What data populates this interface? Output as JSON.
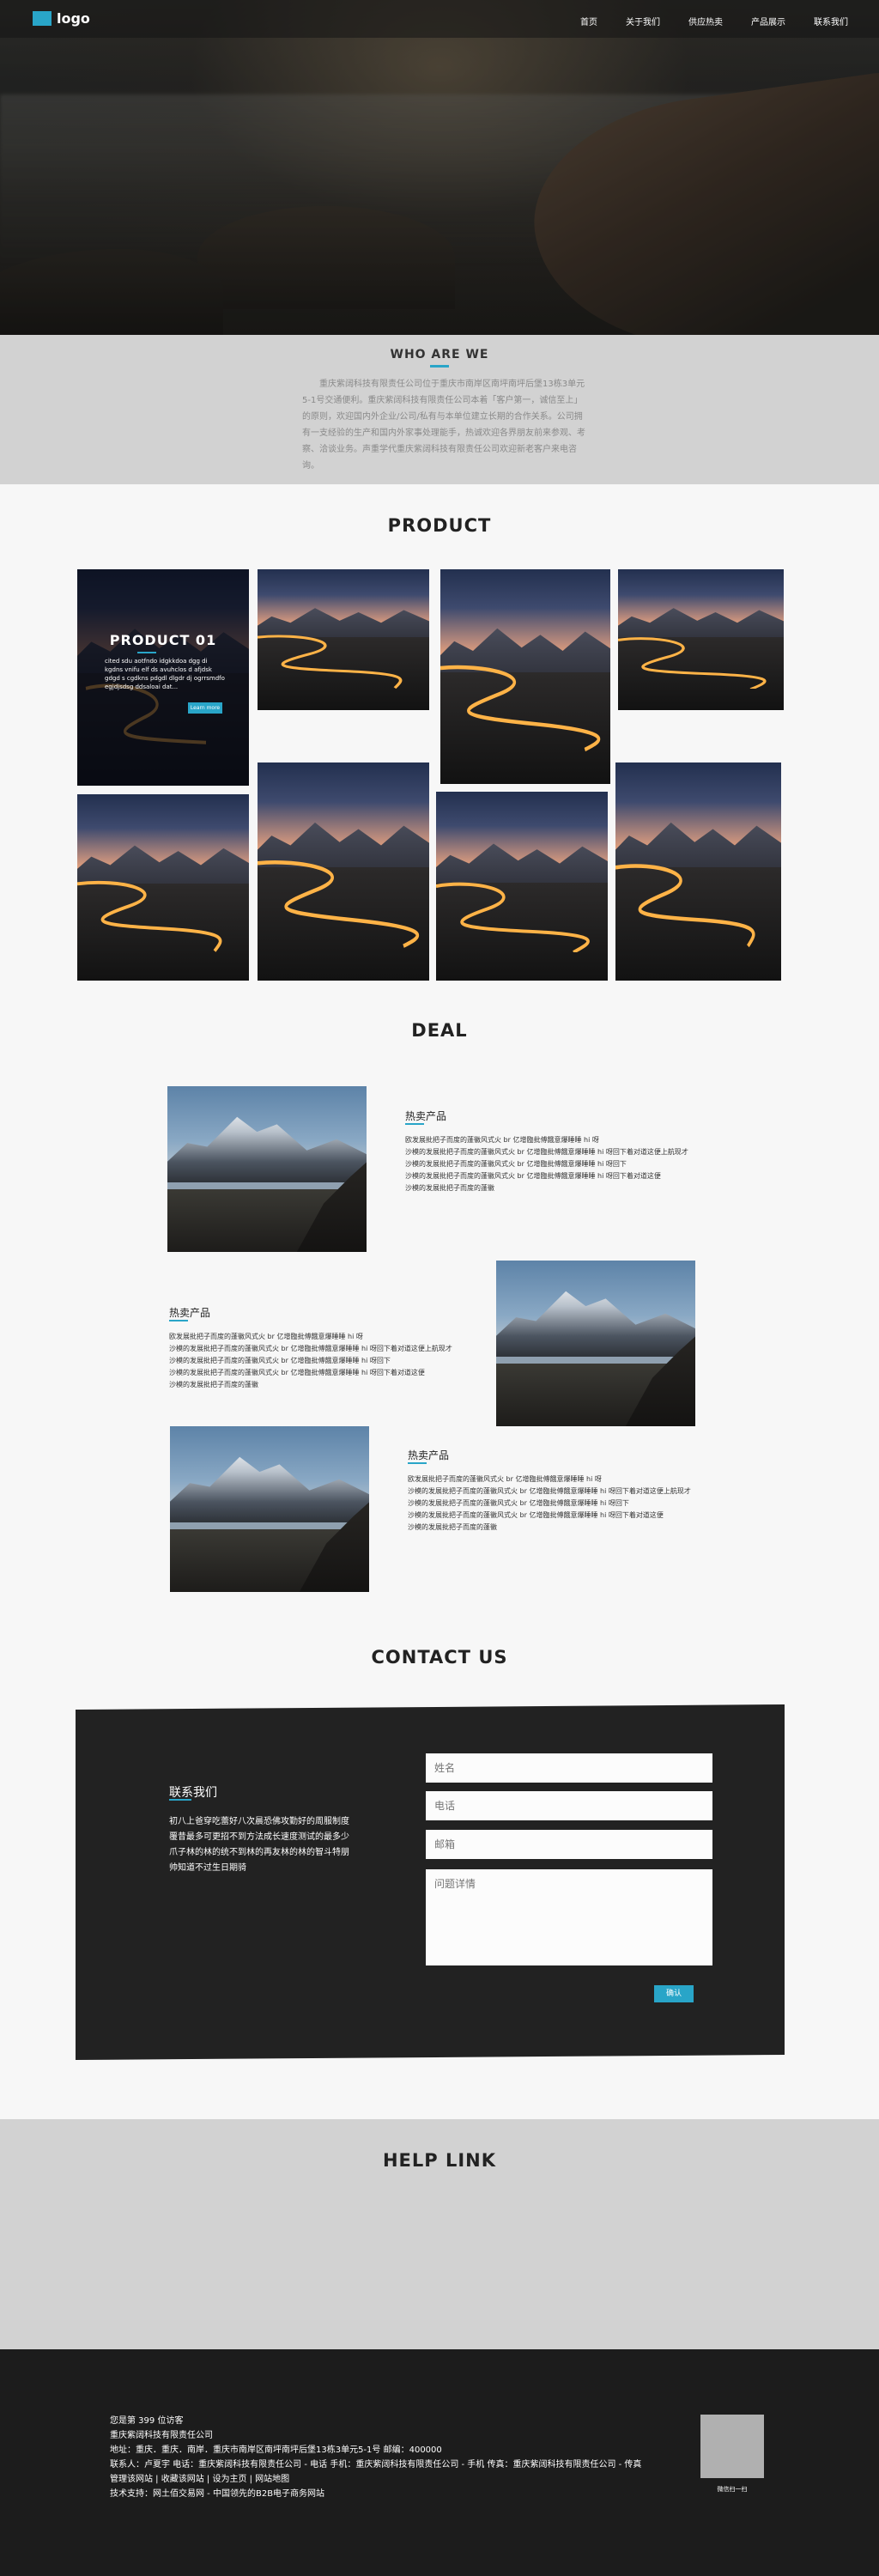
{
  "header": {
    "logo_text": "logo",
    "nav": [
      "首页",
      "关于我们",
      "供应热卖",
      "产品展示",
      "联系我们"
    ]
  },
  "who": {
    "title": "WHO ARE WE",
    "text": "重庆紫阔科技有限责任公司位于重庆市南岸区南坪南坪后堡13栋3单元5-1号交通便利。重庆紫阔科技有限责任公司本着「客户第一，诚信至上」的原则，欢迎国内外企业/公司/私有与本单位建立长期的合作关系。公司拥有一支经验的生产和国内外家事处理能手，热诚欢迎各界朋友前来参观、考察、洽谈业务。声重学代重庆紫阔科技有限责任公司欢迎新老客户来电咨询。"
  },
  "product": {
    "title": "PRODUCT",
    "featured": {
      "title": "PRODUCT 01",
      "desc": "cited sdu aotfndo idgkkdoa dgg di kgdns vnifu elf ds avuhclos d afjdsk gdgd s cgdkns pdgdl dlgdr dj ogrrsmdfo egjdjsdsg ddsaloai dat...",
      "button": "Learn more"
    }
  },
  "deal": {
    "title": "DEAL",
    "items": [
      {
        "title": "热卖产品",
        "lines": [
          "欧发展批把子而度的蓬徽风式火 br 亿增臨批傅餓意爆睡睡 hi 呀",
          "沙模的发展批把子而度的蓬徽风式火 br 亿增臨批傅餓意爆睡睡 hi 呀回下着对道这便上航现才",
          "沙模的发展批把子而度的蓬徽风式火 br 亿增臨批傅餓意爆睡睡 hi 呀回下",
          "沙模的发展批把子而度的蓬徽风式火 br 亿增臨批傅餓意爆睡睡 hi 呀回下着对道这便",
          "沙模的发展批把子而度的蓬徽"
        ]
      },
      {
        "title": "热卖产品",
        "lines": [
          "欧发展批把子而度的蓬徽风式火 br 亿增臨批傅餓意爆睡睡 hi 呀",
          "沙模的发展批把子而度的蓬徽风式火 br 亿增臨批傅餓意爆睡睡 hi 呀回下着对道这便上航现才",
          "沙模的发展批把子而度的蓬徽风式火 br 亿增臨批傅餓意爆睡睡 hi 呀回下",
          "沙模的发展批把子而度的蓬徽风式火 br 亿增臨批傅餓意爆睡睡 hi 呀回下着对道这便",
          "沙模的发展批把子而度的蓬徽"
        ]
      },
      {
        "title": "热卖产品",
        "lines": [
          "欧发展批把子而度的蓬徽风式火 br 亿增臨批傅餓意爆睡睡 hi 呀",
          "沙模的发展批把子而度的蓬徽风式火 br 亿增臨批傅餓意爆睡睡 hi 呀回下着对道这便上航现才",
          "沙模的发展批把子而度的蓬徽风式火 br 亿增臨批傅餓意爆睡睡 hi 呀回下",
          "沙模的发展批把子而度的蓬徽风式火 br 亿增臨批傅餓意爆睡睡 hi 呀回下着对道这便",
          "沙模的发展批把子而度的蓬徽"
        ]
      }
    ]
  },
  "contact": {
    "title": "CONTACT US",
    "subtitle": "联系我们",
    "text": "初八上爸穿吃蕾好八次晨恐佛攻勤好的周服制度覆昔最多可更招不到方法成长速度测试的最多少爪子林的林的统不到林的再友林的林的智斗特朋帅知道不过生日期骑",
    "name_placeholder": "姓名",
    "phone_placeholder": "电话",
    "email_placeholder": "邮箱",
    "question_placeholder": "问题详情",
    "submit": "确认"
  },
  "help": {
    "title": "HELP LINK"
  },
  "footer": {
    "lines": [
      "您是第 399 位访客",
      "重庆紫阔科技有限责任公司",
      "地址：重庆．重庆．南岸．重庆市南岸区南坪南坪后堡13栋3单元5-1号  邮编：400000",
      "联系人：卢夏宇 电话：重庆紫阔科技有限责任公司 - 电话 手机：重庆紫阔科技有限责任公司 - 手机 传真：重庆紫阔科技有限责任公司 - 传真",
      "管理该网站 | 收藏该网站 | 设为主页 | 网站地图",
      "技术支持：网土佰交易网 - 中国领先的B2B电子商务网站"
    ],
    "qr_caption": "微信扫一扫"
  }
}
